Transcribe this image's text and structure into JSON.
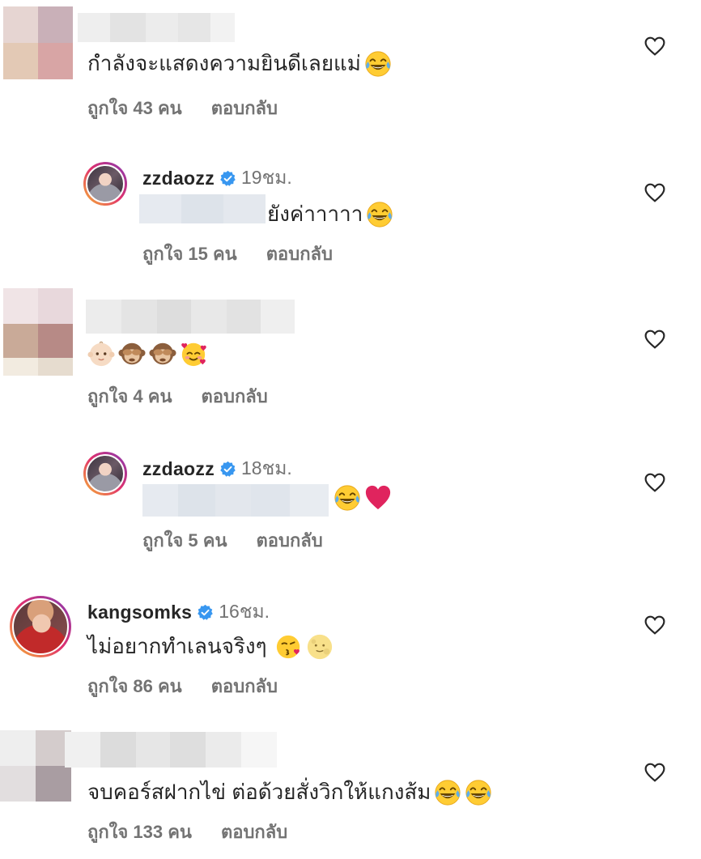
{
  "comments": [
    {
      "text": "กำลังจะแสดงความยินดีเลยแม่",
      "likes": "ถูกใจ 43 คน",
      "reply": "ตอบกลับ"
    },
    {
      "username": "zzdaozz",
      "time": "19ชม.",
      "text": "ยังค่าาาาา",
      "likes": "ถูกใจ 15 คน",
      "reply": "ตอบกลับ"
    },
    {
      "text": "",
      "likes": "ถูกใจ 4 คน",
      "reply": "ตอบกลับ"
    },
    {
      "username": "zzdaozz",
      "time": "18ชม.",
      "text": "",
      "likes": "ถูกใจ 5 คน",
      "reply": "ตอบกลับ"
    },
    {
      "username": "kangsomks",
      "time": "16ชม.",
      "text": "ไม่อยากทำเลนจริงๆ",
      "likes": "ถูกใจ 86 คน",
      "reply": "ตอบกลับ"
    },
    {
      "text": "จบคอร์สฝากไข่ ต่อด้วยสั่งวิกให้แกงส้ม",
      "likes": "ถูกใจ 133 คน",
      "reply": "ตอบกลับ"
    }
  ],
  "icons": {
    "like": "heart-outline-icon",
    "verified": "verified-badge-icon",
    "laugh": "face-with-tears-of-joy-emoji",
    "heart": "red-heart-emoji",
    "baby": "baby-emoji",
    "see_no_evil": "see-no-evil-monkey-emoji",
    "hear_no_evil": "hear-no-evil-monkey-emoji",
    "hearts_face": "smiling-face-with-hearts-emoji",
    "kiss": "face-blowing-kiss-emoji",
    "moon": "full-moon-face-emoji"
  },
  "colors": {
    "text": "#262626",
    "secondary": "#737373",
    "verified": "#3897f0",
    "heart_emoji": "#e0245e"
  }
}
